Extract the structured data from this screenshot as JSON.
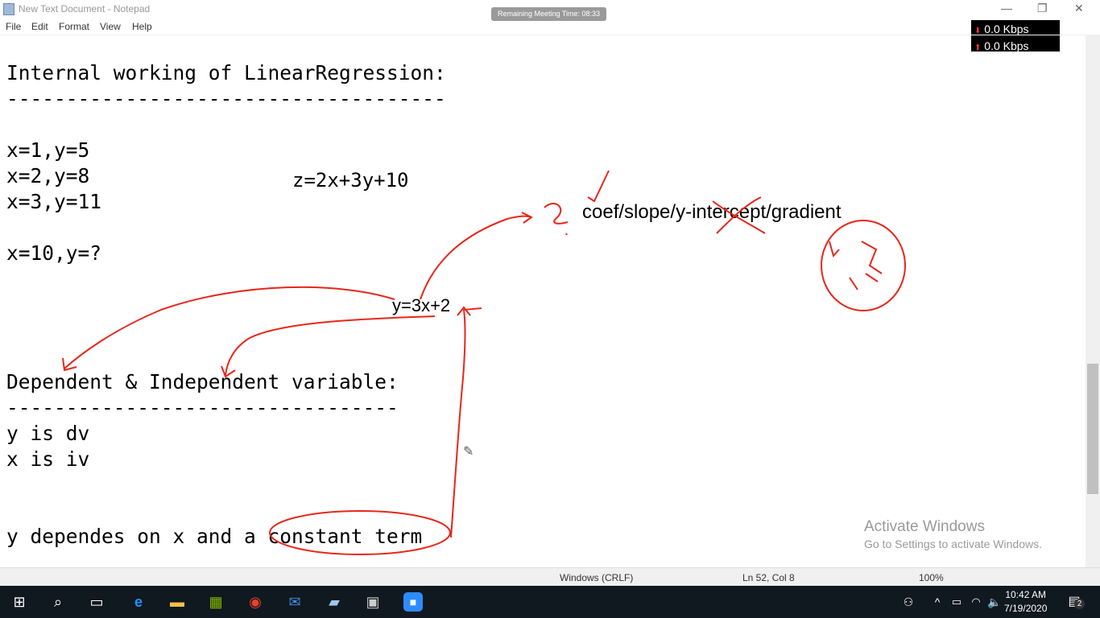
{
  "window": {
    "title": "New Text Document - Notepad",
    "meeting": "Remaining Meeting Time: 08:33"
  },
  "network": {
    "down": "0.0 Kbps",
    "up": "0.0 Kbps"
  },
  "menu": [
    "File",
    "Edit",
    "Format",
    "View",
    "Help"
  ],
  "lines": [
    "Internal working of LinearRegression:",
    "-------------------------------------",
    "",
    "x=1,y=5",
    "x=2,y=8",
    "x=3,y=11",
    "",
    "x=10,y=?",
    "",
    "",
    "",
    "",
    "Dependent & Independent variable:",
    "---------------------------------",
    "y is dv",
    "x is iv",
    "",
    "",
    "y dependes on x and a constant term"
  ],
  "annotations": {
    "z_eq": "z=2x+3y+10",
    "y_eq": "y=3x+2",
    "terms": "coef/slope/y-intercept/gradient"
  },
  "status": {
    "encoding": "Windows (CRLF)",
    "position": "Ln 52, Col 8",
    "zoom": "100%"
  },
  "watermark": {
    "title": "Activate Windows",
    "sub": "Go to Settings to activate Windows."
  },
  "clock": {
    "time": "10:42 AM",
    "date": "7/19/2020",
    "notifications": "2"
  },
  "ink_color": "#e8261b"
}
